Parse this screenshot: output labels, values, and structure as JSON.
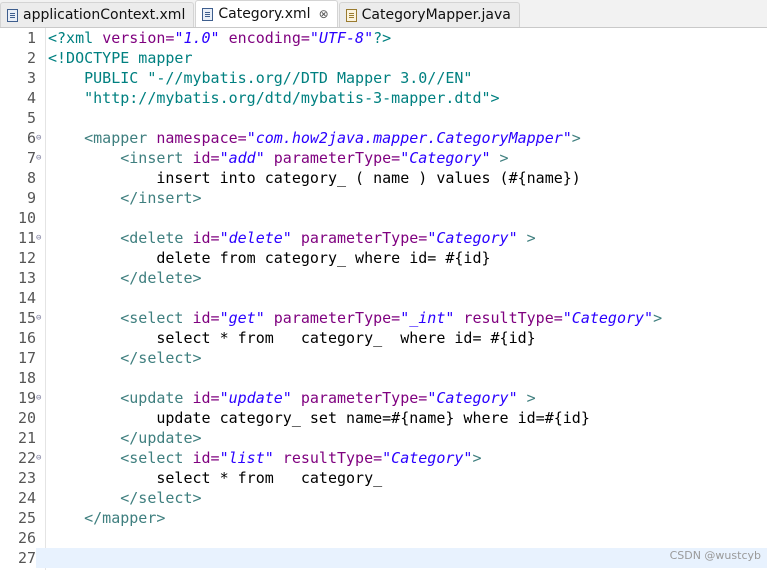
{
  "tabs": [
    {
      "label": "applicationContext.xml",
      "icon": "xml-file-icon",
      "active": false
    },
    {
      "label": "Category.xml",
      "icon": "xml-file-icon",
      "active": true,
      "close": "⊗"
    },
    {
      "label": "CategoryMapper.java",
      "icon": "java-file-icon",
      "active": false
    }
  ],
  "editor": {
    "lines": [
      {
        "n": "1",
        "fold": "",
        "segs": [
          {
            "t": "<?xml ",
            "c": "t-dt"
          },
          {
            "t": "version=",
            "c": "t-attr"
          },
          {
            "t": "\"1.0\"",
            "c": "t-val"
          },
          {
            "t": " encoding=",
            "c": "t-attr"
          },
          {
            "t": "\"UTF-8\"",
            "c": "t-val"
          },
          {
            "t": "?>",
            "c": "t-dt"
          }
        ]
      },
      {
        "n": "2",
        "fold": "",
        "segs": [
          {
            "t": "<!DOCTYPE mapper",
            "c": "t-dt"
          }
        ]
      },
      {
        "n": "3",
        "fold": "",
        "segs": [
          {
            "t": "    PUBLIC ",
            "c": "t-dt"
          },
          {
            "t": "\"-//mybatis.org//DTD Mapper 3.0//EN\"",
            "c": "t-dt"
          }
        ]
      },
      {
        "n": "4",
        "fold": "",
        "segs": [
          {
            "t": "    \"http://mybatis.org/dtd/mybatis-3-mapper.dtd\">",
            "c": "t-dt"
          }
        ]
      },
      {
        "n": "5",
        "fold": "",
        "segs": []
      },
      {
        "n": "6",
        "fold": "⊖",
        "segs": [
          {
            "t": "    <mapper ",
            "c": "t-tag"
          },
          {
            "t": "namespace=",
            "c": "t-attr"
          },
          {
            "t": "\"com.how2java.mapper.CategoryMapper\"",
            "c": "t-val"
          },
          {
            "t": ">",
            "c": "t-tag"
          }
        ]
      },
      {
        "n": "7",
        "fold": "⊖",
        "segs": [
          {
            "t": "        <insert ",
            "c": "t-tag"
          },
          {
            "t": "id=",
            "c": "t-attr"
          },
          {
            "t": "\"add\"",
            "c": "t-val"
          },
          {
            "t": " parameterType=",
            "c": "t-attr"
          },
          {
            "t": "\"Category\"",
            "c": "t-val"
          },
          {
            "t": " >",
            "c": "t-tag"
          }
        ]
      },
      {
        "n": "8",
        "fold": "",
        "segs": [
          {
            "t": "            insert into category_ ( name ) values (#{name})",
            "c": "t-text"
          }
        ]
      },
      {
        "n": "9",
        "fold": "",
        "segs": [
          {
            "t": "        </insert>",
            "c": "t-tag"
          }
        ]
      },
      {
        "n": "10",
        "fold": "",
        "segs": []
      },
      {
        "n": "11",
        "fold": "⊖",
        "segs": [
          {
            "t": "        <delete ",
            "c": "t-tag"
          },
          {
            "t": "id=",
            "c": "t-attr"
          },
          {
            "t": "\"delete\"",
            "c": "t-val"
          },
          {
            "t": " parameterType=",
            "c": "t-attr"
          },
          {
            "t": "\"Category\"",
            "c": "t-val"
          },
          {
            "t": " >",
            "c": "t-tag"
          }
        ]
      },
      {
        "n": "12",
        "fold": "",
        "segs": [
          {
            "t": "            delete from category_ where id= #{id}",
            "c": "t-text"
          }
        ]
      },
      {
        "n": "13",
        "fold": "",
        "segs": [
          {
            "t": "        </delete>",
            "c": "t-tag"
          }
        ]
      },
      {
        "n": "14",
        "fold": "",
        "segs": []
      },
      {
        "n": "15",
        "fold": "⊖",
        "segs": [
          {
            "t": "        <select ",
            "c": "t-tag"
          },
          {
            "t": "id=",
            "c": "t-attr"
          },
          {
            "t": "\"get\"",
            "c": "t-val"
          },
          {
            "t": " parameterType=",
            "c": "t-attr"
          },
          {
            "t": "\"_int\"",
            "c": "t-val"
          },
          {
            "t": " resultType=",
            "c": "t-attr"
          },
          {
            "t": "\"Category\"",
            "c": "t-val"
          },
          {
            "t": ">",
            "c": "t-tag"
          }
        ]
      },
      {
        "n": "16",
        "fold": "",
        "segs": [
          {
            "t": "            select * from   category_  where id= #{id}",
            "c": "t-text"
          }
        ]
      },
      {
        "n": "17",
        "fold": "",
        "segs": [
          {
            "t": "        </select>",
            "c": "t-tag"
          }
        ]
      },
      {
        "n": "18",
        "fold": "",
        "segs": []
      },
      {
        "n": "19",
        "fold": "⊖",
        "segs": [
          {
            "t": "        <update ",
            "c": "t-tag"
          },
          {
            "t": "id=",
            "c": "t-attr"
          },
          {
            "t": "\"update\"",
            "c": "t-val"
          },
          {
            "t": " parameterType=",
            "c": "t-attr"
          },
          {
            "t": "\"Category\"",
            "c": "t-val"
          },
          {
            "t": " >",
            "c": "t-tag"
          }
        ]
      },
      {
        "n": "20",
        "fold": "",
        "segs": [
          {
            "t": "            update category_ set name=#{name} where id=#{id}",
            "c": "t-text"
          }
        ]
      },
      {
        "n": "21",
        "fold": "",
        "segs": [
          {
            "t": "        </update>",
            "c": "t-tag"
          }
        ]
      },
      {
        "n": "22",
        "fold": "⊖",
        "segs": [
          {
            "t": "        <select ",
            "c": "t-tag"
          },
          {
            "t": "id=",
            "c": "t-attr"
          },
          {
            "t": "\"list\"",
            "c": "t-val"
          },
          {
            "t": " resultType=",
            "c": "t-attr"
          },
          {
            "t": "\"Category\"",
            "c": "t-val"
          },
          {
            "t": ">",
            "c": "t-tag"
          }
        ]
      },
      {
        "n": "23",
        "fold": "",
        "segs": [
          {
            "t": "            select * from   category_",
            "c": "t-text"
          }
        ]
      },
      {
        "n": "24",
        "fold": "",
        "segs": [
          {
            "t": "        </select>",
            "c": "t-tag"
          }
        ]
      },
      {
        "n": "25",
        "fold": "",
        "segs": [
          {
            "t": "    </mapper>",
            "c": "t-tag"
          }
        ]
      },
      {
        "n": "26",
        "fold": "",
        "segs": []
      },
      {
        "n": "27",
        "fold": "",
        "segs": [],
        "current": true
      }
    ]
  },
  "watermark": "CSDN @wustcyb"
}
